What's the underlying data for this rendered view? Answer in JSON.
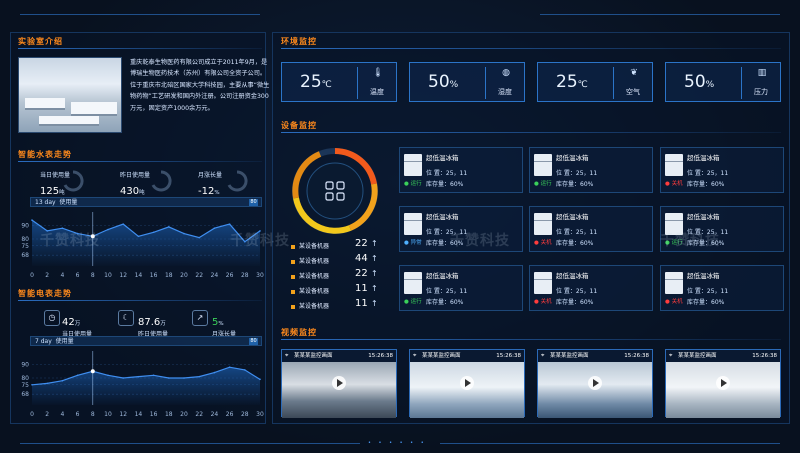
{
  "intro": {
    "title": "实验室介绍",
    "text": "重庆乾泰生物医药有限公司成立于2011年9月，是博瑞生物医药技术（苏州）有限公司全资子公司。位于重庆市北碚区国家大学科技园，主要从事“微生物药物”工艺研发和国内外注册。公司注册资金300万元，固定资产1000余万元。"
  },
  "water": {
    "title": "智能水表走势",
    "stats": [
      {
        "label": "当日使用量",
        "value": "125",
        "unit": "吨"
      },
      {
        "label": "昨日使用量",
        "value": "430",
        "unit": "吨"
      },
      {
        "label": "月涨长量",
        "value": "-12",
        "unit": "%"
      }
    ],
    "range_label": "13  day",
    "usage_label": "使用量",
    "badge": "80"
  },
  "power": {
    "title": "智能电表走势",
    "stats": [
      {
        "label": "当日使用量",
        "value": "42",
        "unit": "万"
      },
      {
        "label": "昨日使用量",
        "value": "87.6",
        "unit": "万"
      },
      {
        "label": "月涨长量",
        "value": "5",
        "unit": "%"
      }
    ],
    "range_label": "7  day",
    "usage_label": "使用量",
    "badge": "80"
  },
  "chart_data": [
    {
      "type": "line",
      "x": [
        0,
        2,
        4,
        6,
        8,
        10,
        12,
        14,
        16,
        18,
        20,
        22,
        24,
        26,
        28,
        30
      ],
      "series": [
        {
          "values": [
            94,
            86,
            88,
            84,
            82,
            87,
            91,
            82,
            85,
            89,
            84,
            81,
            88,
            91,
            78,
            86
          ]
        }
      ],
      "yticks": [
        68,
        75,
        80,
        90
      ],
      "ylim": [
        60,
        100
      ],
      "marker": {
        "x": 8,
        "y": 82
      }
    },
    {
      "type": "line",
      "x": [
        0,
        2,
        4,
        6,
        8,
        10,
        12,
        14,
        16,
        18,
        20,
        22,
        24,
        26,
        28,
        30
      ],
      "series": [
        {
          "values": [
            75,
            76,
            78,
            82,
            85,
            82,
            80,
            81,
            82,
            80,
            80,
            81,
            84,
            88,
            86,
            79
          ]
        }
      ],
      "yticks": [
        68,
        75,
        80,
        90
      ],
      "ylim": [
        60,
        100
      ],
      "marker": {
        "x": 8,
        "y": 85
      }
    }
  ],
  "env": {
    "title": "环境监控",
    "cards": [
      {
        "value": "25",
        "unit": "℃",
        "name": "温度",
        "icon": "thermometer-icon"
      },
      {
        "value": "50",
        "unit": "%",
        "name": "湿度",
        "icon": "droplet-icon"
      },
      {
        "value": "25",
        "unit": "℃",
        "name": "空气",
        "icon": "leaf-icon"
      },
      {
        "value": "50",
        "unit": "%",
        "name": "压力",
        "icon": "gauge-icon"
      }
    ]
  },
  "devices": {
    "title": "设备监控",
    "legend": [
      {
        "label": "某设备机器",
        "value": "22"
      },
      {
        "label": "某设备机器",
        "value": "44"
      },
      {
        "label": "某设备机器",
        "value": "22"
      },
      {
        "label": "某设备机器",
        "value": "11"
      },
      {
        "label": "某设备机器",
        "value": "11"
      }
    ],
    "items": [
      {
        "name": "超低温冰箱",
        "pos_label": "位  置：",
        "pos": "25，11",
        "stock_label": "库存量：",
        "stock": "60%",
        "status": "运行",
        "state": "on"
      },
      {
        "name": "超低温冰箱",
        "pos_label": "位  置：",
        "pos": "25，11",
        "stock_label": "库存量：",
        "stock": "60%",
        "status": "运行",
        "state": "on"
      },
      {
        "name": "超低温冰箱",
        "pos_label": "位  置：",
        "pos": "25，11",
        "stock_label": "库存量：",
        "stock": "60%",
        "status": "关机",
        "state": "off"
      },
      {
        "name": "超低温冰箱",
        "pos_label": "位  置：",
        "pos": "25，11",
        "stock_label": "库存量：",
        "stock": "60%",
        "status": "异常",
        "state": "warn"
      },
      {
        "name": "超低温冰箱",
        "pos_label": "位  置：",
        "pos": "25，11",
        "stock_label": "库存量：",
        "stock": "60%",
        "status": "关机",
        "state": "off"
      },
      {
        "name": "超低温冰箱",
        "pos_label": "位  置：",
        "pos": "25，11",
        "stock_label": "库存量：",
        "stock": "60%",
        "status": "运行",
        "state": "on"
      },
      {
        "name": "超低温冰箱",
        "pos_label": "位  置：",
        "pos": "25，11",
        "stock_label": "库存量：",
        "stock": "60%",
        "status": "运行",
        "state": "on"
      },
      {
        "name": "超低温冰箱",
        "pos_label": "位  置：",
        "pos": "25，11",
        "stock_label": "库存量：",
        "stock": "60%",
        "status": "关机",
        "state": "off"
      },
      {
        "name": "超低温冰箱",
        "pos_label": "位  置：",
        "pos": "25，11",
        "stock_label": "库存量：",
        "stock": "60%",
        "status": "关机",
        "state": "off"
      }
    ]
  },
  "video": {
    "title": "视频监控",
    "cams": [
      {
        "name": "某某某监控画面",
        "time": "15:26:38"
      },
      {
        "name": "某某某监控画面",
        "time": "15:26:38"
      },
      {
        "name": "某某某监控画面",
        "time": "15:26:38"
      },
      {
        "name": "某某某监控画面",
        "time": "15:26:38"
      }
    ]
  },
  "watermark": "千赞科技",
  "colors": {
    "accent": "#ff8a1c",
    "line": "#2b74c8",
    "on": "#3ad05a",
    "off": "#ff3c3c"
  }
}
